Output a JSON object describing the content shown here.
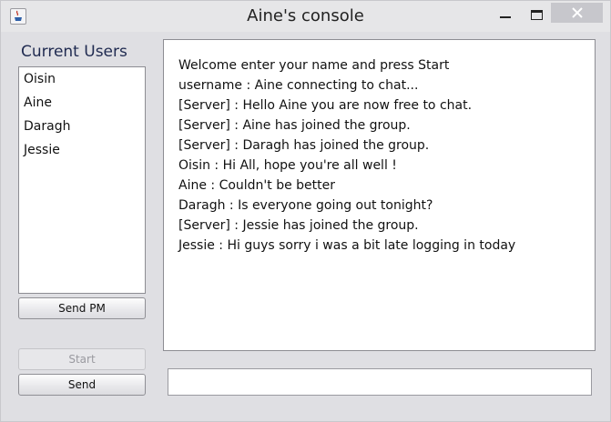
{
  "window": {
    "title": "Aine's console"
  },
  "users_panel": {
    "label": "Current Users",
    "users": [
      "Oisin",
      "Aine",
      "Daragh",
      "Jessie"
    ]
  },
  "buttons": {
    "send_pm": "Send PM",
    "start": "Start",
    "send": "Send"
  },
  "chat": {
    "lines": [
      "Welcome enter your name and press Start",
      "username : Aine connecting to chat...",
      "[Server] : Hello Aine you are now free to chat.",
      "[Server] : Aine has joined the group.",
      "[Server] : Daragh has joined the group.",
      "Oisin : Hi All, hope you're all well !",
      "Aine : Couldn't be better",
      "Daragh : Is everyone going out tonight?",
      "[Server] : Jessie has joined the group.",
      "Jessie : Hi guys sorry i was a bit late logging in today"
    ]
  },
  "message_input": {
    "value": ""
  },
  "icons": {
    "app": "java-coffee-icon",
    "minimize": "minimize-icon",
    "maximize": "maximize-icon",
    "close": "close-icon"
  },
  "colors": {
    "window_bg": "#dfdfe3",
    "close_button": "#c7c7cc"
  }
}
